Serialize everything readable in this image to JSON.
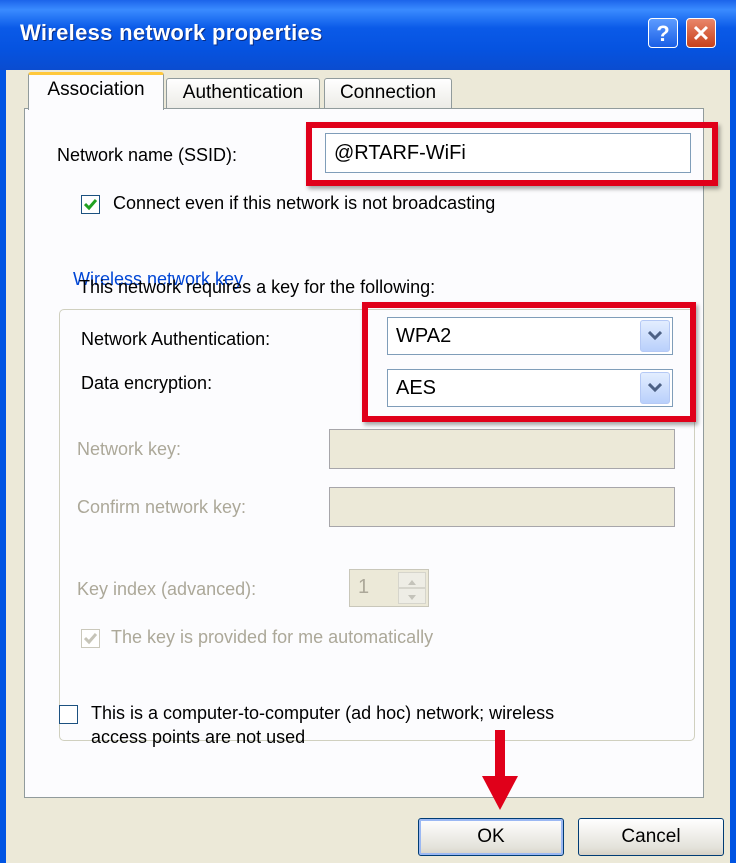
{
  "window": {
    "title": "Wireless network properties",
    "help_glyph": "?",
    "close_glyph": "✕"
  },
  "tabs": [
    {
      "label": "Association"
    },
    {
      "label": "Authentication"
    },
    {
      "label": "Connection"
    }
  ],
  "association": {
    "ssid_label": "Network name (SSID):",
    "ssid_value": "@RTARF-WiFi",
    "broadcast_checkbox": {
      "label": "Connect even if this network is not broadcasting",
      "checked": true
    },
    "key_group_title": "Wireless network key",
    "requires_text": "This network requires a key for the following:",
    "auth_label": "Network Authentication:",
    "auth_value": "WPA2",
    "encryption_label": "Data encryption:",
    "encryption_value": "AES",
    "network_key_label": "Network key:",
    "confirm_key_label": "Confirm network key:",
    "key_index_label": "Key index (advanced):",
    "key_index_value": "1",
    "auto_key_checkbox": {
      "label": "The key is provided for me automatically",
      "checked": true,
      "disabled": true
    },
    "adhoc_checkbox": {
      "label_line1": "This is a computer-to-computer (ad hoc) network; wireless",
      "label_line2": "access points are not used",
      "checked": false
    }
  },
  "buttons": {
    "ok": "OK",
    "cancel": "Cancel"
  },
  "colors": {
    "highlight": "#E0001A",
    "titlebar": "#0054E3",
    "group_title": "#0046D5"
  }
}
